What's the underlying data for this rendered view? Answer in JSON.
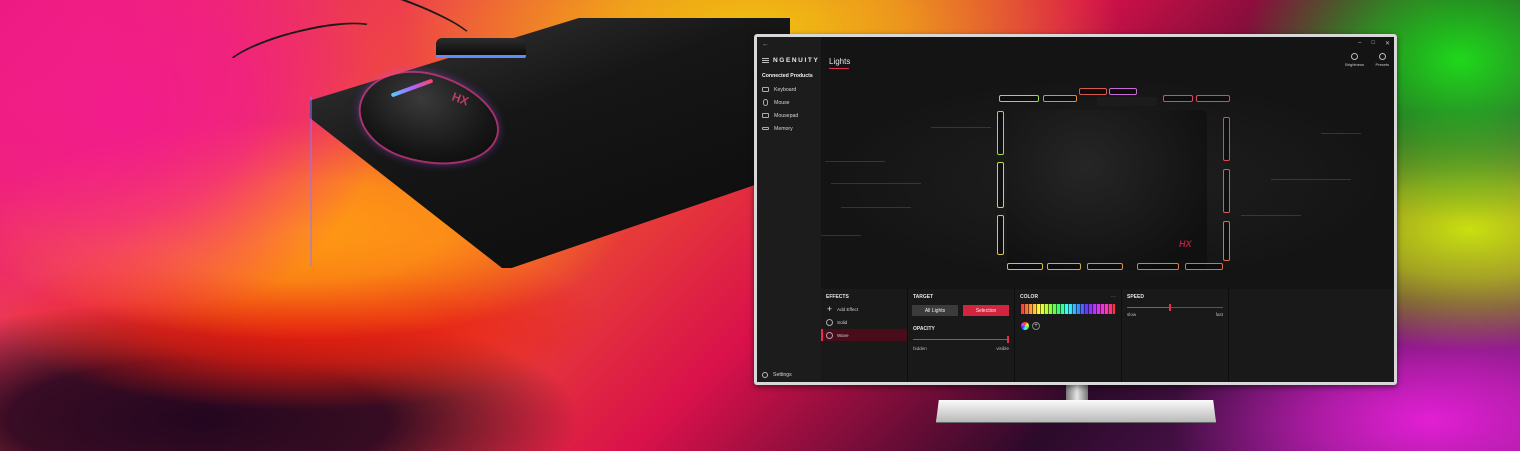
{
  "app": {
    "brand": "NGENUITY",
    "back_icon": "back-arrow-icon",
    "window_controls": [
      "–",
      "□",
      "✕"
    ]
  },
  "sidebar": {
    "heading": "Connected Products",
    "items": [
      {
        "label": "Keyboard",
        "icon": "keyboard-icon"
      },
      {
        "label": "Mouse",
        "icon": "mouse-icon"
      },
      {
        "label": "Mousepad",
        "icon": "mousepad-icon"
      },
      {
        "label": "Memory",
        "icon": "memory-icon"
      }
    ],
    "settings_label": "Settings"
  },
  "main": {
    "title": "Lights",
    "toolbar": [
      {
        "label": "Brightness",
        "icon": "brightness-icon"
      },
      {
        "label": "Presets",
        "icon": "presets-icon"
      }
    ]
  },
  "effects": {
    "heading": "EFFECTS",
    "add_label": "Add Effect",
    "items": [
      {
        "label": "Solid",
        "active": false
      },
      {
        "label": "Wave",
        "active": true
      }
    ]
  },
  "target": {
    "heading": "TARGET",
    "all_lights_label": "All Lights",
    "selection_label": "Selection",
    "opacity_heading": "OPACITY",
    "opacity_min_label": "hidden",
    "opacity_max_label": "visible",
    "opacity_value": 1.0
  },
  "color": {
    "heading": "COLOR",
    "menu": "...",
    "add_label": "+"
  },
  "speed": {
    "heading": "SPEED",
    "min_label": "slow",
    "max_label": "fast",
    "value": 0.45
  },
  "colors": {
    "accent": "#e0304a",
    "selection_button": "#d3243e",
    "panel": "#191919"
  },
  "product_logo": "HX"
}
